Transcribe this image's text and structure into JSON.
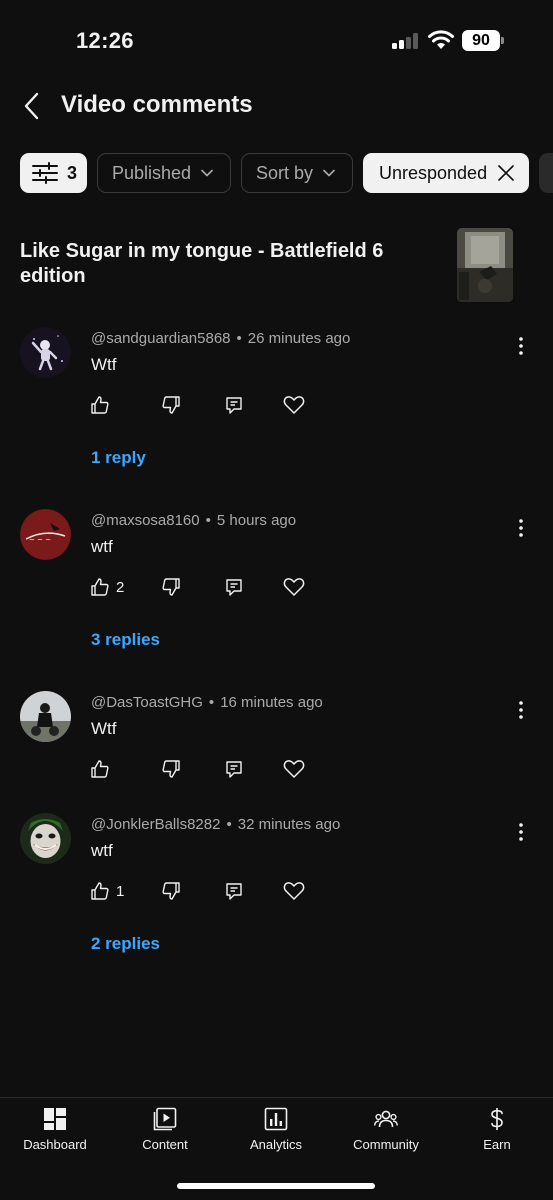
{
  "status_bar": {
    "time": "12:26",
    "battery": "90"
  },
  "header": {
    "title": "Video comments"
  },
  "filters": {
    "filter_count": "3",
    "published_label": "Published",
    "sort_label": "Sort by",
    "active_label": "Unresponded"
  },
  "video": {
    "title": "Like Sugar in my tongue - Battlefield 6 edition"
  },
  "comments": [
    {
      "author": "@sandguardian5868",
      "time": "26 minutes ago",
      "text": "Wtf",
      "likes": "",
      "replies": "1 reply"
    },
    {
      "author": "@maxsosa8160",
      "time": "5 hours ago",
      "text": "wtf",
      "likes": "2",
      "replies": "3 replies"
    },
    {
      "author": "@DasToastGHG",
      "time": "16 minutes ago",
      "text": "Wtf",
      "likes": "",
      "replies": ""
    },
    {
      "author": "@JonklerBalls8282",
      "time": "32 minutes ago",
      "text": "wtf",
      "likes": "1",
      "replies": "2 replies"
    }
  ],
  "nav": [
    {
      "label": "Dashboard",
      "icon": "dashboard-icon"
    },
    {
      "label": "Content",
      "icon": "content-icon"
    },
    {
      "label": "Analytics",
      "icon": "analytics-icon"
    },
    {
      "label": "Community",
      "icon": "community-icon"
    },
    {
      "label": "Earn",
      "icon": "earn-icon"
    }
  ],
  "colors": {
    "background": "#0f0f0f",
    "link": "#3ea6ff",
    "chip_active": "#f1f1f1",
    "text_secondary": "#aaaaaa"
  }
}
